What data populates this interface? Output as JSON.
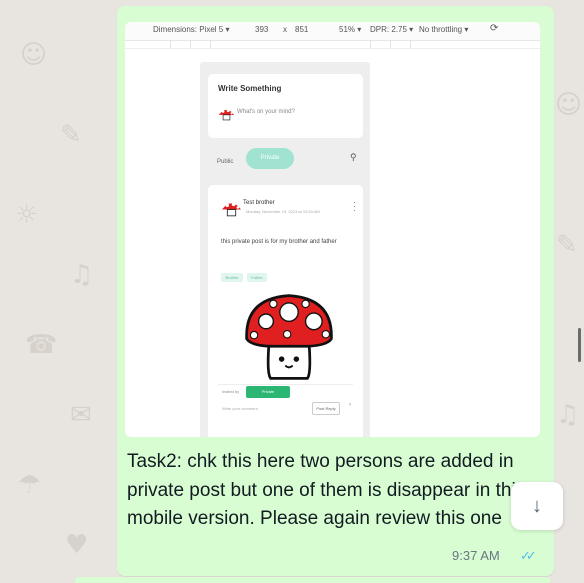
{
  "screenshot": {
    "toolbar": {
      "dimensions": "Dimensions: Pixel 5 ▾",
      "width": "393",
      "times": "x",
      "height": "851",
      "zoom": "51% ▾",
      "dpr": "DPR: 2.75 ▾",
      "throttle": "No throttling ▾",
      "rotate_icon": "rotate-icon"
    },
    "write": {
      "title": "Write Something",
      "placeholder": "What's on your mind?"
    },
    "visibility": {
      "public": "Public",
      "private": "Private",
      "search_icon": "search-icon"
    },
    "post": {
      "author": "Test brother",
      "date": "Monday, November 13, 2023 at 10:45 AM",
      "menu_icon": "more-vertical-icon",
      "text": "this private post is for my brother and father",
      "tags": [
        "Brother",
        "Father"
      ],
      "invited_label": "Invited by",
      "invited_chip": "Private",
      "comment_placeholder": "Write your comment",
      "post_button": "Post Reply",
      "arrow": "›"
    }
  },
  "message": {
    "text": "Task2: chk this here two persons are added in private post but one of them is disappear in this mobile version. Please again review this one",
    "time": "9:37 AM",
    "status_icon": "double-check-icon",
    "status_glyph": "✓✓"
  },
  "scroll_down": {
    "icon": "arrow-down-icon",
    "glyph": "↓"
  },
  "colors": {
    "bubble": "#d9fdd3",
    "background": "#e8e4df",
    "read_ticks": "#53bdeb",
    "private_button": "#9fe3d0",
    "invite_chip": "#2bb673",
    "mushroom_red": "#e02020"
  }
}
